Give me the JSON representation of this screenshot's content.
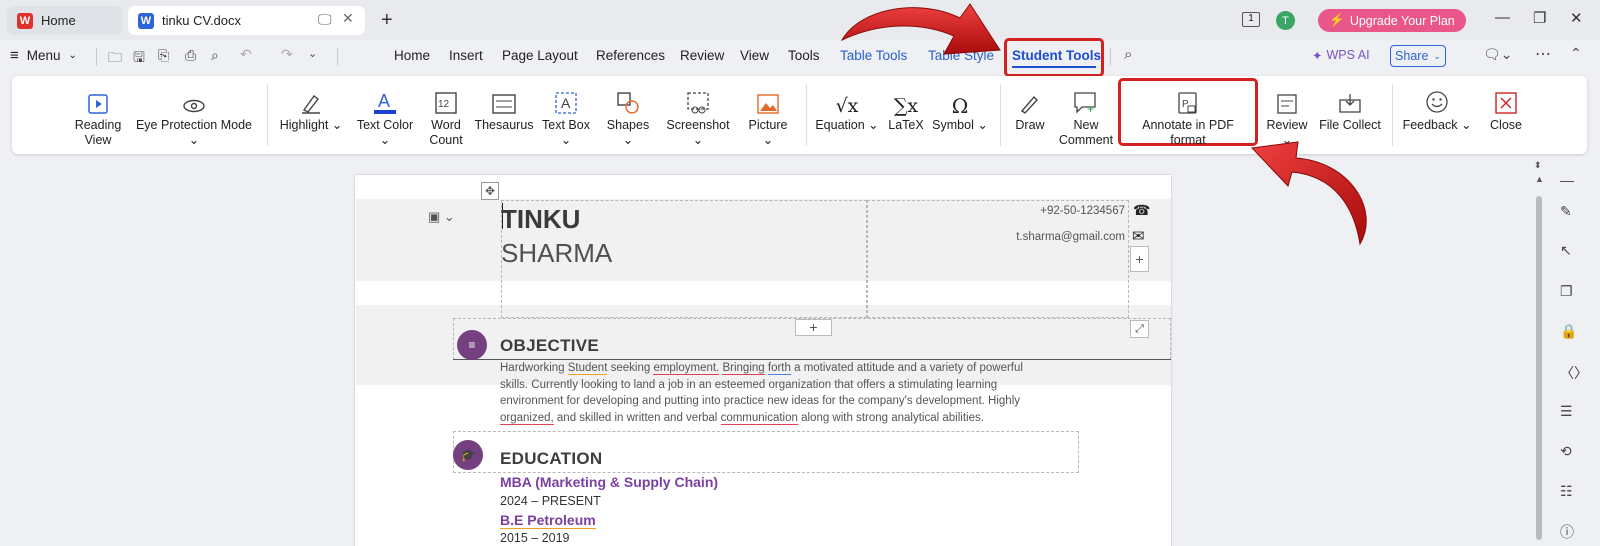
{
  "tabs": {
    "home": "Home",
    "doc": "tinku CV.docx"
  },
  "topbar": {
    "upgrade": "Upgrade Your Plan",
    "avatar": "T",
    "page_indicator": "1"
  },
  "menu": {
    "menu_label": "Menu",
    "tabs": [
      "Home",
      "Insert",
      "Page Layout",
      "References",
      "Review",
      "View",
      "Tools",
      "Table Tools",
      "Table Style",
      "Student Tools"
    ],
    "wps_ai": "WPS AI",
    "share": "Share"
  },
  "ribbon": {
    "reading_view": "Reading\nView",
    "eye_protection": "Eye Protection Mode",
    "highlight": "Highlight",
    "text_color": "Text Color",
    "word_count": "Word\nCount",
    "thesaurus": "Thesaurus",
    "text_box": "Text Box",
    "shapes": "Shapes",
    "screenshot": "Screenshot",
    "picture": "Picture",
    "equation": "Equation",
    "latex": "LaTeX",
    "symbol": "Symbol",
    "draw": "Draw",
    "new_comment": "New\nComment",
    "annotate_pdf": "Annotate in PDF format",
    "review": "Review",
    "file_collect": "File Collect",
    "feedback": "Feedback",
    "close": "Close"
  },
  "document": {
    "first_name": "TINKU",
    "last_name": "SHARMA",
    "phone": "+92-50-1234567",
    "email": "t.sharma@gmail.com",
    "objective_heading": "OBJECTIVE",
    "objective_lines": [
      "Hardworking Student seeking employment. Bringing forth a motivated attitude and a variety of powerful",
      "skills. Currently looking to land a job in an esteemed organization that offers a stimulating learning",
      "environment for developing and putting into practice new ideas for the company's development. Highly",
      "organized, and skilled in written and verbal communication along with strong analytical abilities."
    ],
    "education_heading": "EDUCATION",
    "edu1_degree": "MBA (Marketing & Supply Chain)",
    "edu1_years": "2024 – PRESENT",
    "edu2_degree": "B.E Petroleum",
    "edu2_years": "2015 – 2019"
  },
  "colors": {
    "accent_red": "#d42020",
    "brand_purple": "#74407f",
    "upgrade_pink": "#e9578a",
    "active_tab_blue": "#1d4fd1"
  }
}
